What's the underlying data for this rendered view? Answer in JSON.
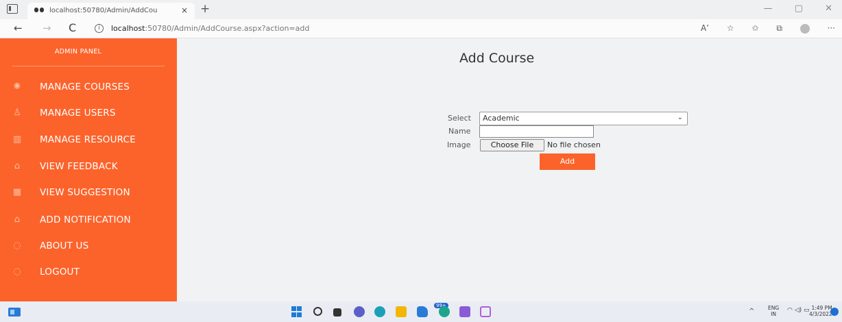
{
  "browser": {
    "tab_title": "localhost:50780/Admin/AddCou",
    "tab_close": "×",
    "new_tab": "+",
    "url_host": "localhost",
    "url_rest": ":50780/Admin/AddCourse.aspx?action=add",
    "back_glyph": "←",
    "forward_glyph": "→",
    "reload_glyph": "C",
    "info_glyph": "i",
    "read_aloud": "Aʼ",
    "win_minimize": "—",
    "win_maximize": "▢",
    "win_close": "✕"
  },
  "sidebar": {
    "title": "ADMIN PANEL",
    "items": [
      {
        "label": "MANAGE COURSES",
        "icon": "atom-icon",
        "glyph": "✺"
      },
      {
        "label": "MANAGE USERS",
        "icon": "user-icon",
        "glyph": "♙"
      },
      {
        "label": "MANAGE RESOURCE",
        "icon": "book-icon",
        "glyph": "▥"
      },
      {
        "label": "VIEW FEEDBACK",
        "icon": "bell-icon",
        "glyph": "⌂"
      },
      {
        "label": "VIEW SUGGESTION",
        "icon": "calculator-icon",
        "glyph": "▦"
      },
      {
        "label": "ADD NOTIFICATION",
        "icon": "bell-icon",
        "glyph": "⌂"
      },
      {
        "label": "ABOUT US",
        "icon": "power-icon",
        "glyph": "◌"
      },
      {
        "label": "LOGOUT",
        "icon": "power-icon",
        "glyph": "◌"
      }
    ]
  },
  "main": {
    "title": "Add Course",
    "select_label": "Select",
    "select_value": "Academic",
    "name_label": "Name",
    "name_value": "",
    "image_label": "Image",
    "file_button": "Choose File",
    "file_status": "No file chosen",
    "submit_label": "Add"
  },
  "taskbar": {
    "badge": "99+",
    "lang_top": "ENG",
    "lang_bottom": "IN",
    "time": "1:49 PM",
    "date": "4/3/2022",
    "tray_chevron": "^"
  },
  "colors": {
    "sidebar_bg": "#fc632b",
    "button_bg": "#fc632b",
    "page_bg": "#f1f2f4"
  }
}
